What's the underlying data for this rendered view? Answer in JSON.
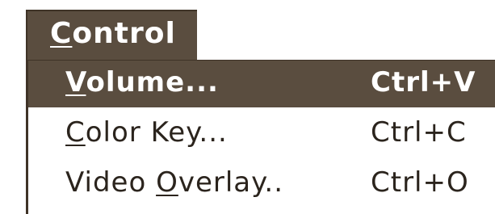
{
  "menubar": {
    "title": {
      "mnemonic": "C",
      "rest": "ontrol"
    }
  },
  "dropdown": {
    "items": [
      {
        "before": "",
        "mnemonic": "V",
        "after": "olume...",
        "shortcut": "Ctrl+V",
        "selected": true
      },
      {
        "before": "",
        "mnemonic": "C",
        "after": "olor Key...",
        "shortcut": "Ctrl+C",
        "selected": false
      },
      {
        "before": "Video ",
        "mnemonic": "O",
        "after": "verlay..",
        "shortcut": "Ctrl+O",
        "selected": false
      }
    ]
  },
  "colors": {
    "highlight": "#5a4d3f",
    "border": "#3f3327",
    "text": "#2b241d",
    "background": "#ffffff"
  }
}
